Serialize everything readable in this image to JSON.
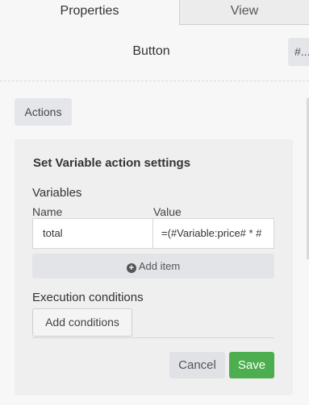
{
  "tabs": [
    {
      "label": "Properties",
      "active": true
    },
    {
      "label": "View",
      "active": false
    }
  ],
  "element": {
    "name": "Button",
    "id_chip": "#..."
  },
  "actions_button": "Actions",
  "action_settings": {
    "title": "Set Variable action settings",
    "variables_label": "Variables",
    "columns": {
      "name": "Name",
      "value": "Value"
    },
    "variable": {
      "name": "total",
      "value": "=(#Variable:price# * #"
    },
    "add_item": "Add item",
    "execution_conditions_label": "Execution conditions",
    "add_conditions": "Add conditions",
    "cancel": "Cancel",
    "save": "Save"
  },
  "colors": {
    "save": "#4cae4f",
    "panel": "#efefef",
    "chip": "#e4e6ea"
  },
  "icons": {
    "add_item": "plus-circle-icon"
  }
}
